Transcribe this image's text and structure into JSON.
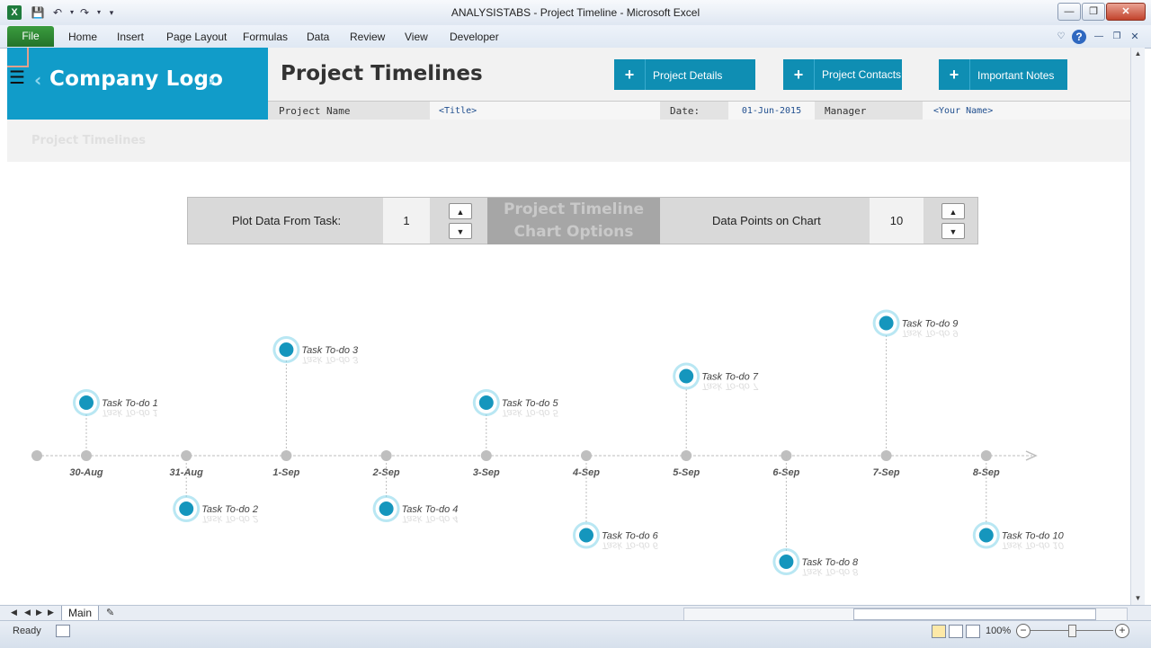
{
  "window": {
    "title": "ANALYSISTABS - Project Timeline - Microsoft Excel",
    "app_icon": "excel-icon",
    "controls": [
      "minimize",
      "restore",
      "close"
    ]
  },
  "ribbon": {
    "file_label": "File",
    "tabs": [
      "Home",
      "Insert",
      "Page Layout",
      "Formulas",
      "Data",
      "Review",
      "View",
      "Developer"
    ]
  },
  "header": {
    "logo_text": "Company Logo",
    "page_title": "Project Timelines",
    "buttons": [
      {
        "label": "Project Details",
        "icon": "plus-icon"
      },
      {
        "label": "Project Contacts",
        "icon": "plus-icon"
      },
      {
        "label": "Important Notes",
        "icon": "plus-icon"
      }
    ],
    "info": {
      "project_name_label": "Project Name",
      "project_name_value": "<Title>",
      "date_label": "Date:",
      "date_value": "01-Jun-2015",
      "manager_label": "Manager",
      "manager_value": "<Your Name>"
    },
    "subtitle": "Project Timelines"
  },
  "options": {
    "plot_from_label": "Plot Data From Task:",
    "plot_from_value": "1",
    "title_line1": "Project Timeline",
    "title_line2": "Chart Options",
    "points_label": "Data Points on Chart",
    "points_value": "10"
  },
  "chart_data": {
    "type": "timeline",
    "dates": [
      "30-Aug",
      "31-Aug",
      "1-Sep",
      "2-Sep",
      "3-Sep",
      "4-Sep",
      "5-Sep",
      "6-Sep",
      "7-Sep",
      "8-Sep"
    ],
    "tasks": [
      {
        "name": "Task To-do 1",
        "date": "30-Aug",
        "level": 1
      },
      {
        "name": "Task To-do 2",
        "date": "31-Aug",
        "level": -1
      },
      {
        "name": "Task To-do 3",
        "date": "1-Sep",
        "level": 2
      },
      {
        "name": "Task To-do 4",
        "date": "2-Sep",
        "level": -1
      },
      {
        "name": "Task To-do 5",
        "date": "3-Sep",
        "level": 1
      },
      {
        "name": "Task To-do 6",
        "date": "4-Sep",
        "level": -1.5
      },
      {
        "name": "Task To-do 7",
        "date": "5-Sep",
        "level": 1.5
      },
      {
        "name": "Task To-do 8",
        "date": "6-Sep",
        "level": -2
      },
      {
        "name": "Task To-do 9",
        "date": "7-Sep",
        "level": 2.5
      },
      {
        "name": "Task To-do 10",
        "date": "8-Sep",
        "level": -1.5
      }
    ],
    "colors": {
      "marker": "#1596bd",
      "halo": "#7fd3ea",
      "axis": "#bdbdbd",
      "dot": "#bfbfbf"
    }
  },
  "sheet_tabs": [
    "Main"
  ],
  "status": {
    "ready": "Ready",
    "zoom": "100%"
  }
}
